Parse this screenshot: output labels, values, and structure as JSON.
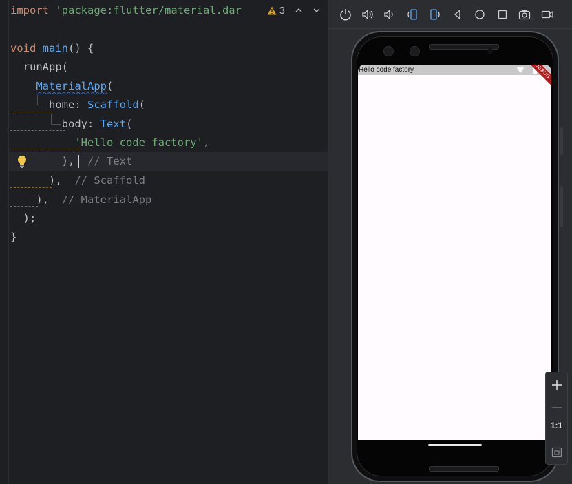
{
  "editor": {
    "lines": {
      "import_kw": "import",
      "import_str": "'package:flutter/material.dar",
      "void": "void",
      "main": "main",
      "main_rest": "() {",
      "runapp": "runApp(",
      "materialapp": "MaterialApp",
      "paren_open": "(",
      "home": "home: ",
      "scaffold": "Scaffold",
      "body": "body: ",
      "text": "Text",
      "hello": "'Hello code factory'",
      "comma": ",",
      "close_text": "),",
      "comment_text": "// Text",
      "close_scaffold": "),",
      "comment_scaffold": "// Scaffold",
      "close_material": "),",
      "comment_material": "// MaterialApp",
      "close_runapp": ");",
      "close_main": "}"
    },
    "warnings": {
      "count": "3",
      "icon": "warning-triangle-icon"
    }
  },
  "emulator": {
    "toolbar": {
      "icons": [
        "power-icon",
        "volume-up-icon",
        "volume-down-icon",
        "rotate-left-icon",
        "rotate-right-icon",
        "back-icon",
        "home-icon",
        "overview-icon",
        "screenshot-icon",
        "record-icon"
      ]
    },
    "app": {
      "status_text": "Hello code factory",
      "debug_banner": "DEBUG"
    },
    "zoom": {
      "label": "1:1"
    }
  },
  "colors": {
    "editor_bg": "#1e1f22",
    "keyword": "#cf8e6d",
    "function": "#57aaf7",
    "string": "#6aab73",
    "comment": "#7a7e85",
    "screen_bg": "#fffbfe",
    "debug_red": "#b71c1c"
  }
}
